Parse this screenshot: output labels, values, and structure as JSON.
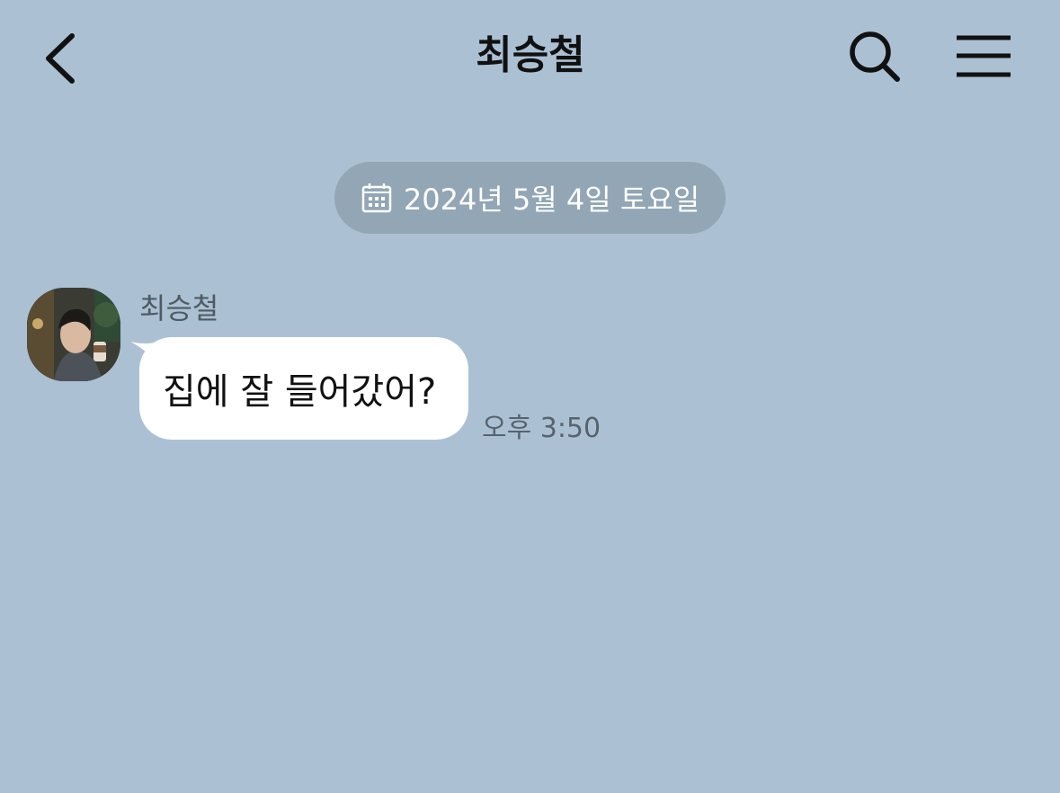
{
  "header": {
    "title": "최승철",
    "icons": {
      "back": "chevron-left-icon",
      "search": "search-icon",
      "menu": "hamburger-menu-icon"
    }
  },
  "date_divider": {
    "text": "2024년 5월 4일 토요일",
    "icon": "calendar-icon"
  },
  "messages": [
    {
      "sender": "최승철",
      "text": "집에 잘 들어갔어?",
      "time": "오후 3:50"
    }
  ],
  "colors": {
    "background": "#abc1d3",
    "date_pill": "#92a6b5",
    "bubble": "#ffffff"
  }
}
